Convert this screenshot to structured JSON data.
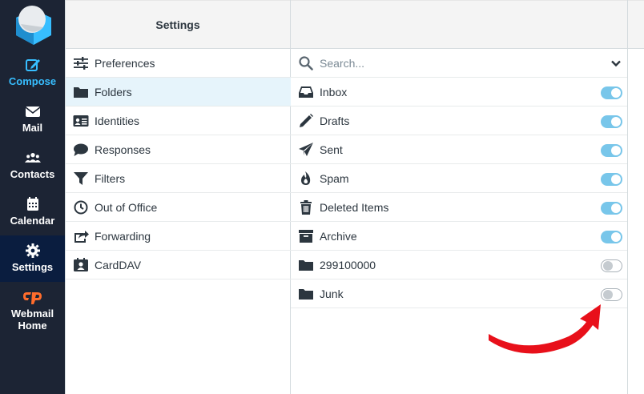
{
  "nav": {
    "items": [
      {
        "label": "Compose",
        "icon": "compose-icon"
      },
      {
        "label": "Mail",
        "icon": "mail-icon"
      },
      {
        "label": "Contacts",
        "icon": "contacts-icon"
      },
      {
        "label": "Calendar",
        "icon": "calendar-icon"
      },
      {
        "label": "Settings",
        "icon": "settings-icon"
      },
      {
        "label": "Webmail Home",
        "icon": "cpanel-icon"
      }
    ],
    "active": "Settings",
    "accent": "#37beff",
    "cpanel_color": "#ff6c2c"
  },
  "settings": {
    "title": "Settings",
    "items": [
      {
        "label": "Preferences",
        "icon": "sliders-icon"
      },
      {
        "label": "Folders",
        "icon": "folder-icon"
      },
      {
        "label": "Identities",
        "icon": "id-card-icon"
      },
      {
        "label": "Responses",
        "icon": "comment-icon"
      },
      {
        "label": "Filters",
        "icon": "filter-icon"
      },
      {
        "label": "Out of Office",
        "icon": "clock-icon"
      },
      {
        "label": "Forwarding",
        "icon": "share-icon"
      },
      {
        "label": "CardDAV",
        "icon": "address-book-icon"
      }
    ],
    "selected": "Folders"
  },
  "folders": {
    "search": {
      "placeholder": "Search...",
      "value": ""
    },
    "items": [
      {
        "label": "Inbox",
        "icon": "inbox-icon",
        "subscribed": true
      },
      {
        "label": "Drafts",
        "icon": "pencil-icon",
        "subscribed": true
      },
      {
        "label": "Sent",
        "icon": "paper-plane-icon",
        "subscribed": true
      },
      {
        "label": "Spam",
        "icon": "fire-icon",
        "subscribed": true
      },
      {
        "label": "Deleted Items",
        "icon": "trash-icon",
        "subscribed": true
      },
      {
        "label": "Archive",
        "icon": "archive-icon",
        "subscribed": true
      },
      {
        "label": "299100000",
        "icon": "folder-icon",
        "subscribed": false
      },
      {
        "label": "Junk",
        "icon": "folder-icon",
        "subscribed": false
      }
    ],
    "toggle_on_color": "#78c6ea"
  },
  "annotation": {
    "color": "#e8101a"
  }
}
